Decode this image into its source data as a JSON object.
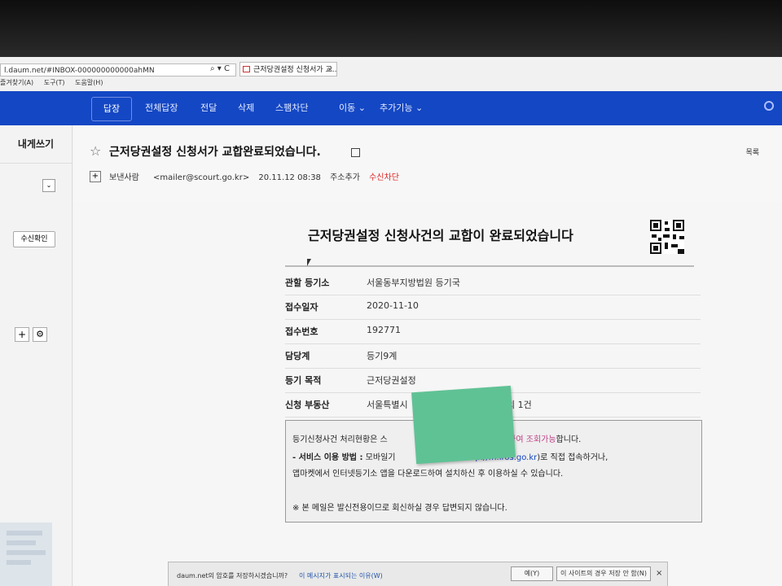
{
  "browser": {
    "address": "l.daum.net/#INBOX-000000000000ahMN",
    "tab_title": "근저당권설정 신청서가 교...",
    "tab_close": "×",
    "menu": [
      "즐겨찾기(A)",
      "도구(T)",
      "도움말(H)"
    ],
    "search_glyph": "⌕ ▾ C"
  },
  "nav": {
    "items": [
      "답장",
      "전체답장",
      "전달",
      "삭제",
      "스팸차단",
      "이동 ⌄",
      "추가기능 ⌄"
    ]
  },
  "sidebar": {
    "compose": "내게쓰기",
    "select_glyph": "⌄",
    "read_receipt": "수신확인",
    "plus": "+",
    "gear": "⚙"
  },
  "header": {
    "star": "☆",
    "subject": "근저당권설정 신청서가 교합완료되었습니다.",
    "list_link": "목록",
    "expand": "+",
    "sender_label": "보낸사람",
    "sender_email": "<mailer@scourt.go.kr>",
    "date": "20.11.12 08:38",
    "add_contact": "주소추가",
    "block": "수신차단"
  },
  "body": {
    "title": "근저당권설정 신청사건의 교합이 완료되었습니다",
    "rows": [
      {
        "label": "관할 등기소",
        "value": "서울동부지방법원 등기국"
      },
      {
        "label": "접수일자",
        "value": "2020-11-10"
      },
      {
        "label": "접수번호",
        "value": "192771"
      },
      {
        "label": "담당계",
        "value": "등기9계"
      },
      {
        "label": "등기 목적",
        "value": "근저당권설정"
      },
      {
        "label": "신청 부동산",
        "value": "서울특별시",
        "value_tail": "외 1건"
      }
    ],
    "info": {
      "line1_a": "등기신청사건 처리현황은 스",
      "line1_b": "이용하여 조회가능",
      "line1_c": "합니다.",
      "line2_label": "- 서비스 이용 방법 :",
      "line2_a": "모바일기",
      "line2_link": "ttp://m.iros.go.kr",
      "line2_b": ")로 직접 접속하거나,",
      "line3": "앱마켓에서 인터넷등기소 앱을 다운로드하여 설치하신 후 이용하실 수 있습니다.",
      "notice": "※ 본 메일은 발신전용이므로 회신하실 경우 답변되지 않습니다."
    }
  },
  "notification": {
    "message": "daum.net의 암호를 저장하시겠습니까?",
    "why": "이 메시지가 표시되는 이유(W)",
    "yes": "예(Y)",
    "never": "이 사이트의 경우 저장 안 함(N)",
    "close": "×"
  }
}
